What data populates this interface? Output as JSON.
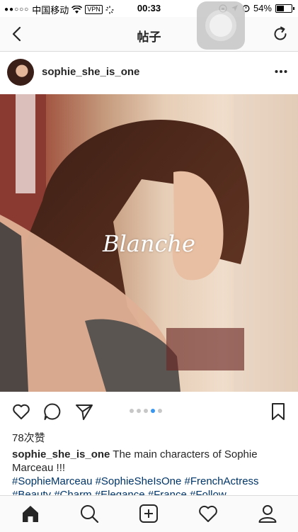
{
  "status_bar": {
    "signal_dots": "●●○○○",
    "carrier": "中国移动",
    "vpn": "VPN",
    "time": "00:33",
    "battery": "54%",
    "battery_level": 0.54
  },
  "nav": {
    "title": "帖子"
  },
  "post": {
    "username": "sophie_she_is_one",
    "image_watermark": "Blanche",
    "carousel": {
      "count": 5,
      "active_index": 3
    },
    "likes": "78次赞",
    "caption_user": "sophie_she_is_one",
    "caption_text": " The main characters of Sophie Marceau !!!",
    "hashtags": "#SophieMarceau #SophieSheIsOne #FrenchActress #Beauty #Charm #Elegance #France #Follow"
  },
  "colors": {
    "text": "#262626",
    "hashtag": "#003569",
    "accent": "#3897f0",
    "border": "#dbdbdb"
  },
  "icons": {
    "nav_back": "back-chevron-icon",
    "nav_refresh": "refresh-icon",
    "more": "more-dots-icon",
    "like": "heart-icon",
    "comment": "comment-icon",
    "share": "send-icon",
    "save": "bookmark-icon",
    "tab_home": "home-icon",
    "tab_search": "search-icon",
    "tab_new": "new-post-icon",
    "tab_activity": "heart-icon",
    "tab_profile": "profile-icon"
  }
}
